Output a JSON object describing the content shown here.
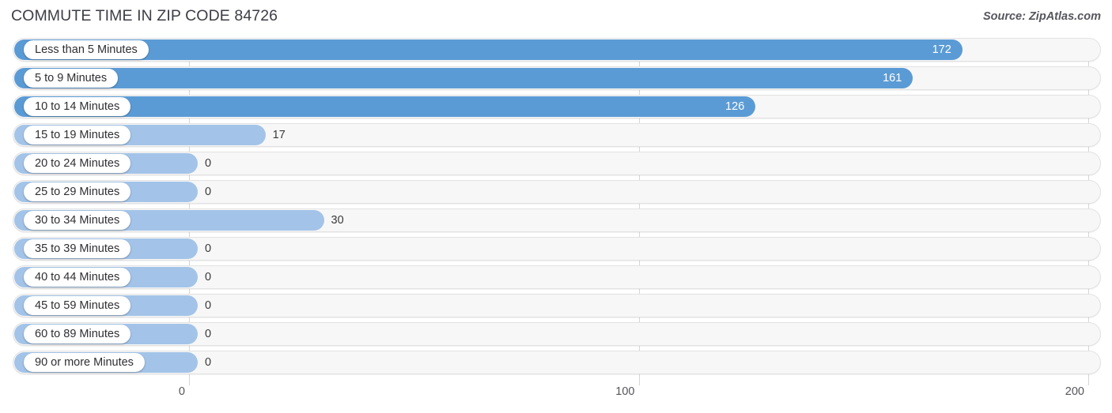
{
  "header": {
    "title": "COMMUTE TIME IN ZIP CODE 84726",
    "source": "Source: ZipAtlas.com"
  },
  "colors": {
    "bar_dark": "#5b9bd5",
    "bar_light": "#a3c4e8",
    "track": "#f7f7f7",
    "gridline": "#d6d6d6",
    "title_text": "#3d3d46"
  },
  "chart_data": {
    "type": "bar",
    "orientation": "horizontal",
    "title": "COMMUTE TIME IN ZIP CODE 84726",
    "xlabel": "",
    "ylabel": "",
    "xlim": [
      0,
      200
    ],
    "grid": true,
    "legend": "none",
    "xticks": [
      "0",
      "100",
      "200"
    ],
    "xtick_values": [
      0,
      100,
      200
    ],
    "categories": [
      "Less than 5 Minutes",
      "5 to 9 Minutes",
      "10 to 14 Minutes",
      "15 to 19 Minutes",
      "20 to 24 Minutes",
      "25 to 29 Minutes",
      "30 to 34 Minutes",
      "35 to 39 Minutes",
      "40 to 44 Minutes",
      "45 to 59 Minutes",
      "60 to 89 Minutes",
      "90 or more Minutes"
    ],
    "values": [
      172,
      161,
      126,
      17,
      0,
      0,
      30,
      0,
      0,
      0,
      0,
      0
    ],
    "value_labels": [
      "172",
      "161",
      "126",
      "17",
      "0",
      "0",
      "30",
      "0",
      "0",
      "0",
      "0",
      "0"
    ]
  }
}
